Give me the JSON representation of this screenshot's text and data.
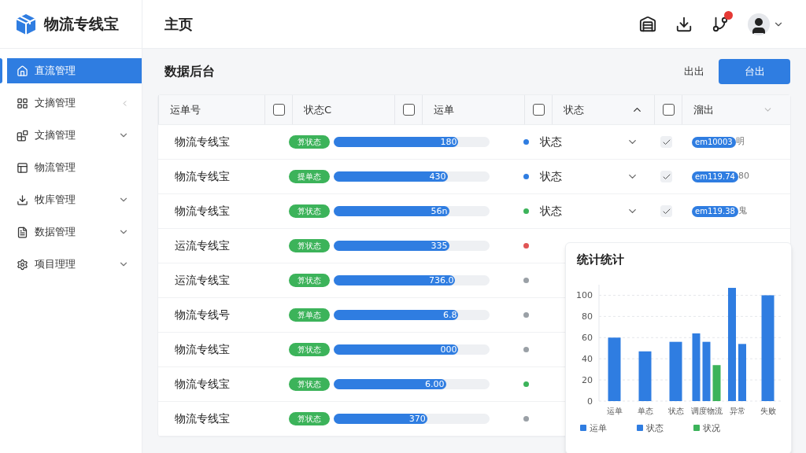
{
  "brand": {
    "name": "物流专线宝"
  },
  "sidebar": {
    "items": [
      {
        "label": "直流管理",
        "selected": true,
        "kind": "link"
      },
      {
        "label": "文摘管理",
        "selected": false,
        "kind": "collapsed"
      },
      {
        "label": "文摘管理",
        "selected": false,
        "kind": "group"
      },
      {
        "label": "物流管理",
        "selected": false,
        "kind": "link"
      },
      {
        "label": "牧库管理",
        "selected": false,
        "kind": "group"
      },
      {
        "label": "数据管理",
        "selected": false,
        "kind": "group"
      },
      {
        "label": "项目理理",
        "selected": false,
        "kind": "group"
      }
    ]
  },
  "header": {
    "title": "主页",
    "notification_badge": true
  },
  "page": {
    "title": "数据后台",
    "buttons": [
      {
        "label": "出出",
        "kind": "text"
      },
      {
        "label": "台出",
        "kind": "primary"
      }
    ]
  },
  "table": {
    "columns": [
      {
        "label": "运单号"
      },
      {
        "label": "状态C",
        "checked": false
      },
      {
        "label": "运单",
        "checked": false
      },
      {
        "label": "状态",
        "checked": false,
        "sort_ascending": true
      },
      {
        "label": "溜出",
        "checked": false,
        "sort_ascending": false
      }
    ],
    "rows": [
      {
        "name": "物流专线宝",
        "badge": "算状态",
        "level": 0.8,
        "value": "180",
        "color": "#2f7de1",
        "status": "状态",
        "checked": true,
        "code": "em10003",
        "code_suffix": "明"
      },
      {
        "name": "物流专线宝",
        "badge": "提单态",
        "level": 0.73,
        "value": "430",
        "color": "#2f7de1",
        "status": "状态",
        "checked": true,
        "code": "em119.74",
        "code_suffix": "80"
      },
      {
        "name": "物流专线宝",
        "badge": "算状态",
        "level": 0.74,
        "value": "56n",
        "color": "#3cb35a",
        "status": "状态",
        "checked": true,
        "code": "em119.38",
        "code_suffix": "鬼"
      },
      {
        "name": "运流专线宝",
        "badge": "算状态",
        "level": 0.74,
        "value": "335",
        "color": "#e05555"
      },
      {
        "name": "运流专线宝",
        "badge": "算状态",
        "level": 0.78,
        "value": "736.0",
        "color": "#9aa0a6"
      },
      {
        "name": "物流专线号",
        "badge": "算单态",
        "level": 0.8,
        "value": "6.8",
        "color": "#9aa0a6"
      },
      {
        "name": "物流专线宝",
        "badge": "算状态",
        "level": 0.8,
        "value": "000",
        "color": "#9aa0a6"
      },
      {
        "name": "物流专线宝",
        "badge": "算状态",
        "level": 0.72,
        "value": "6.00",
        "color": "#3cb35a"
      },
      {
        "name": "物流专线宝",
        "badge": "算状态",
        "level": 0.6,
        "value": "370",
        "color": "#9aa0a6"
      }
    ]
  },
  "stats_card": {
    "title": "统计统计",
    "chart_data": {
      "type": "bar",
      "categories": [
        "运单",
        "单态",
        "状态",
        "调度物流",
        "异常",
        "失败"
      ],
      "series": [
        {
          "name": "运单",
          "color": "#2f7de1",
          "values": [
            60,
            47,
            56,
            64,
            107,
            100
          ]
        },
        {
          "name": "状态",
          "color": "#2f7de1",
          "values": [
            null,
            null,
            null,
            56,
            54,
            null
          ]
        },
        {
          "name": "状况",
          "color": "#3cb35a",
          "values": [
            null,
            null,
            null,
            34,
            null,
            null
          ]
        }
      ],
      "grid": true,
      "legend": true,
      "ylim": [
        0,
        110
      ],
      "yticks": [
        0,
        20,
        40,
        60,
        80,
        100
      ]
    }
  }
}
